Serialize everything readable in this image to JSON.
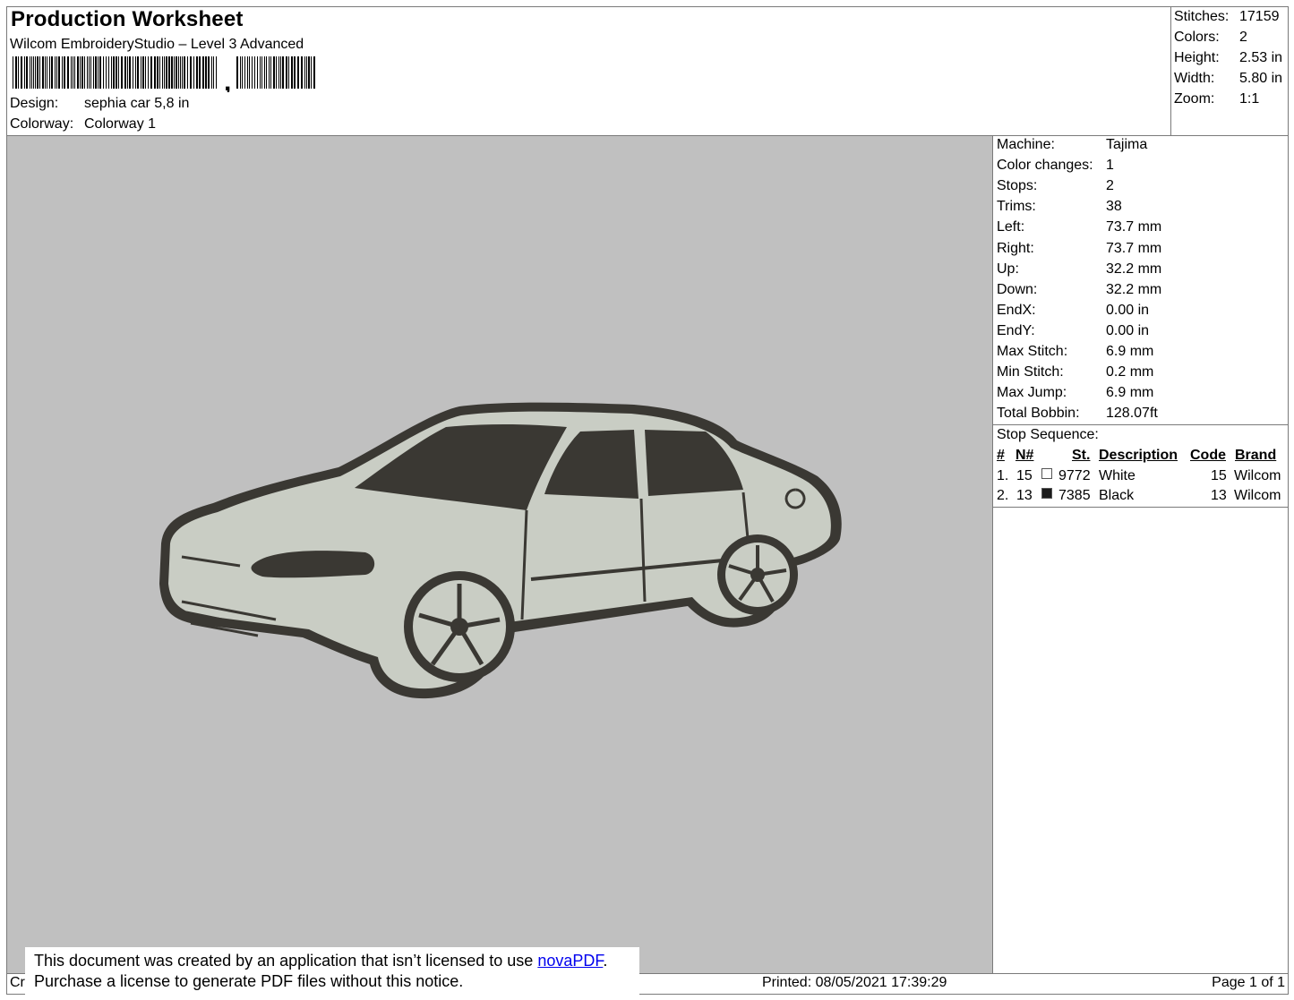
{
  "header": {
    "title": "Production Worksheet",
    "app": "Wilcom EmbroideryStudio – Level 3 Advanced",
    "barcode_sep": ",",
    "design_label": "Design:",
    "design_value": "sephia car 5,8 in",
    "colorway_label": "Colorway:",
    "colorway_value": "Colorway 1"
  },
  "summary": [
    {
      "label": "Stitches:",
      "value": "17159"
    },
    {
      "label": "Colors:",
      "value": "2"
    },
    {
      "label": "Height:",
      "value": "2.53 in"
    },
    {
      "label": "Width:",
      "value": "5.80 in"
    },
    {
      "label": "Zoom:",
      "value": "1:1"
    }
  ],
  "machine": [
    {
      "label": "Machine:",
      "value": "Tajima"
    },
    {
      "label": "Color changes:",
      "value": "1"
    },
    {
      "label": "Stops:",
      "value": "2"
    },
    {
      "label": "Trims:",
      "value": "38"
    },
    {
      "label": "Left:",
      "value": "73.7 mm"
    },
    {
      "label": "Right:",
      "value": "73.7 mm"
    },
    {
      "label": "Up:",
      "value": "32.2 mm"
    },
    {
      "label": "Down:",
      "value": "32.2 mm"
    },
    {
      "label": "EndX:",
      "value": "0.00 in"
    },
    {
      "label": "EndY:",
      "value": "0.00 in"
    },
    {
      "label": "Max Stitch:",
      "value": "6.9 mm"
    },
    {
      "label": "Min Stitch:",
      "value": "0.2 mm"
    },
    {
      "label": "Max Jump:",
      "value": "6.9 mm"
    },
    {
      "label": "Total Bobbin:",
      "value": "128.07ft"
    }
  ],
  "stops": {
    "heading": "Stop Sequence:",
    "columns": [
      "#",
      "N#",
      "St.",
      "Description",
      "Code",
      "Brand"
    ],
    "rows": [
      {
        "idx": "1.",
        "n": "15",
        "color": "#ffffff",
        "st": "9772",
        "desc": "White",
        "code": "15",
        "brand": "Wilcom"
      },
      {
        "idx": "2.",
        "n": "13",
        "color": "#1a1a1a",
        "st": "7385",
        "desc": "Black",
        "code": "13",
        "brand": "Wilcom"
      }
    ]
  },
  "preview": {
    "background": "#c0c0c0",
    "fill_color": "#c9cdc4",
    "outline_color": "#3a3833"
  },
  "footer": {
    "cr": "Cr",
    "printed": "Printed: 08/05/2021 17:39:29",
    "page": "Page 1 of 1"
  },
  "notice": {
    "line1_pre": "This document was created by an application that isn’t licensed to use ",
    "link": "novaPDF",
    "line1_post": ".",
    "line2": "Purchase a license to generate PDF files without this notice."
  }
}
